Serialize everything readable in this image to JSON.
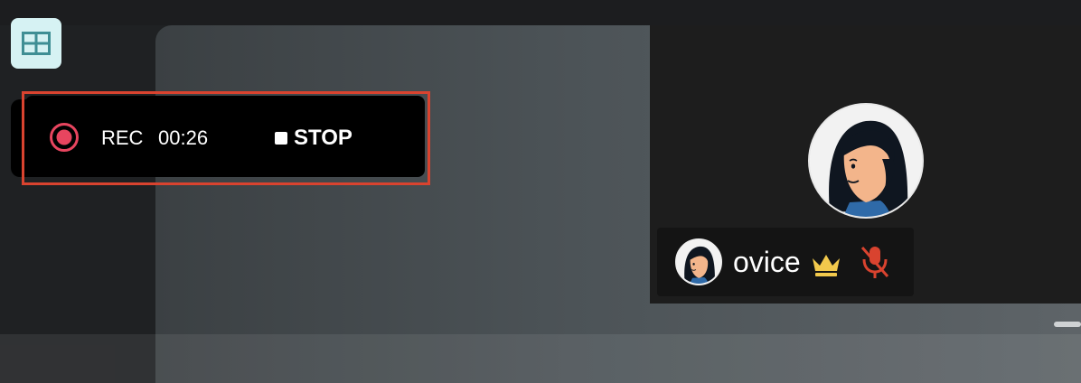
{
  "app": {
    "layout_toggle_icon": "grid-layout-icon",
    "accent_color": "#d6f2f3"
  },
  "recording": {
    "status_label": "REC",
    "elapsed": "00:26",
    "stop_label": "STOP",
    "indicator_color": "#e8455f",
    "outline_color": "#d9432f"
  },
  "participant": {
    "name": "ovice",
    "is_host": true,
    "host_icon": "crown-icon",
    "mic_muted": true,
    "mic_icon": "mic-muted-icon",
    "mic_color": "#d9432f"
  }
}
